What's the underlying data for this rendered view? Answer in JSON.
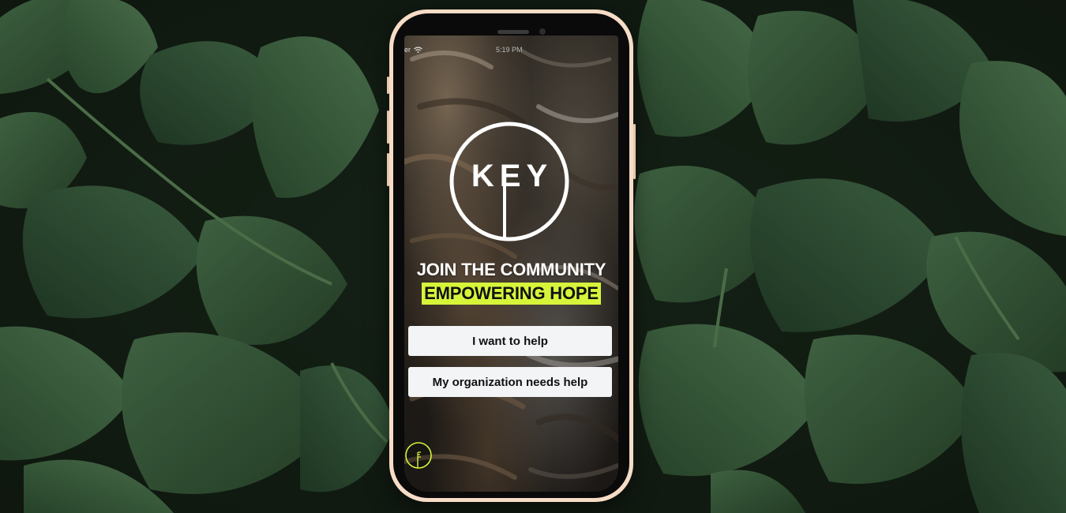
{
  "status_bar": {
    "carrier": "er",
    "time": "5:19 PM"
  },
  "logo": {
    "text": "KEY",
    "icon": "key-logo-icon"
  },
  "headline": {
    "line1": "JOIN THE COMMUNITY",
    "line2": "EMPOWERING HOPE",
    "highlight_color": "#d6f53a"
  },
  "buttons": {
    "help": "I want to help",
    "org": "My organization needs help"
  },
  "colors": {
    "phone_frame": "#f6dcc6",
    "accent": "#d6f53a"
  }
}
